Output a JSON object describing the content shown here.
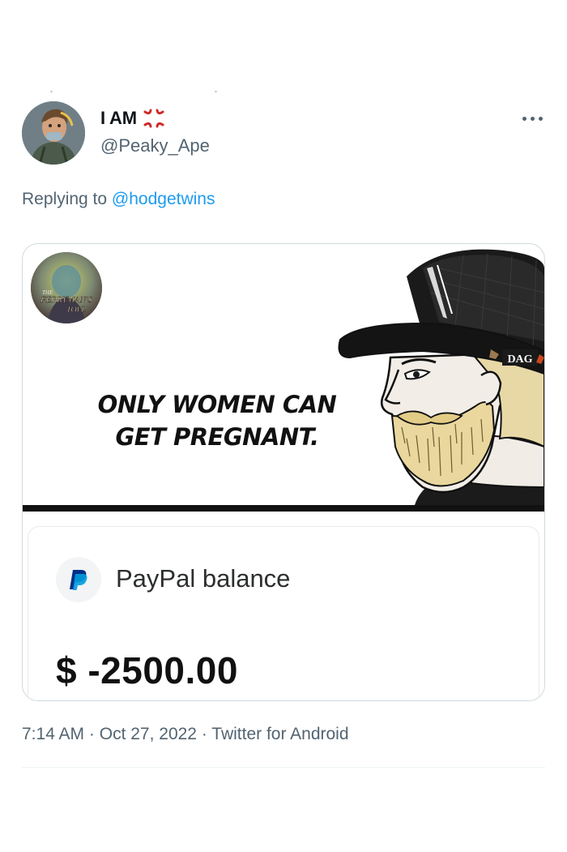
{
  "tweet": {
    "author": {
      "display_name": "I AM",
      "status_icon": "anger-symbol-icon",
      "handle": "@Peaky_Ape"
    },
    "replying_prefix": "Replying to",
    "replying_handle": "@hodgetwins",
    "meme": {
      "caption_line1": "ONLY WOMEN CAN",
      "caption_line2": "GET PREGNANT.",
      "badge_text": "THE FERRYMAN'S TOLL",
      "hat_tag": "DAG"
    },
    "paypal": {
      "label": "PayPal balance",
      "balance": "$ -2500.00"
    },
    "meta": {
      "time": "7:14 AM",
      "date": "Oct 27, 2022",
      "source": "Twitter for Android"
    }
  },
  "colors": {
    "link": "#1d9bf0",
    "secondary_text": "#536471",
    "paypal_dark_blue": "#003087",
    "paypal_light_blue": "#009cde"
  }
}
